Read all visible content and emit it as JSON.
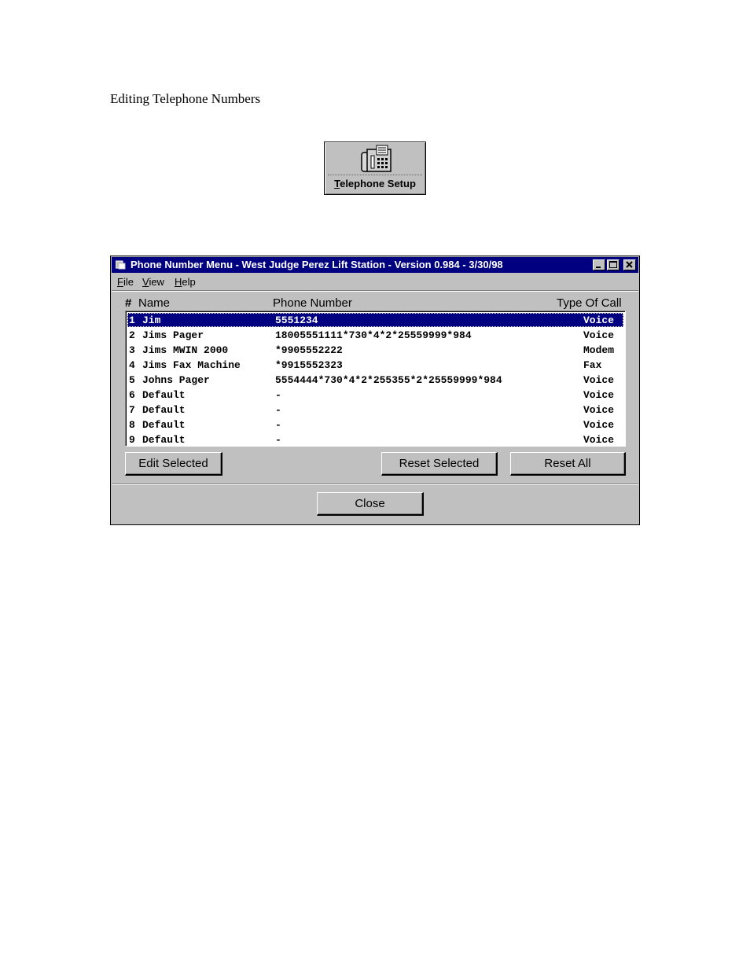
{
  "doc": {
    "heading": "Editing Telephone Numbers"
  },
  "telephone_button": {
    "label_first": "T",
    "label_rest": "elephone Setup",
    "icon": "telephone-fax-icon"
  },
  "window": {
    "title": "Phone Number Menu - West Judge Perez Lift Station - Version 0.984 - 3/30/98",
    "title_color": "#000080",
    "menu": [
      {
        "key": "F",
        "rest": "ile"
      },
      {
        "key": "V",
        "rest": "iew"
      },
      {
        "key": "H",
        "rest": "elp"
      }
    ],
    "columns": {
      "hash": "#",
      "name": "Name",
      "phone": "Phone Number",
      "type": "Type Of Call"
    },
    "rows": [
      {
        "num": "1",
        "name": "Jim",
        "phone": "5551234",
        "type": "Voice",
        "selected": true
      },
      {
        "num": "2",
        "name": "Jims Pager",
        "phone": "18005551111*730*4*2*25559999*984",
        "type": "Voice"
      },
      {
        "num": "3",
        "name": "Jims MWIN 2000",
        "phone": "*9905552222",
        "type": "Modem"
      },
      {
        "num": "4",
        "name": "Jims Fax Machine",
        "phone": "*9915552323",
        "type": "Fax"
      },
      {
        "num": "5",
        "name": "Johns Pager",
        "phone": "5554444*730*4*2*255355*2*25559999*984",
        "type": "Voice"
      },
      {
        "num": "6",
        "name": "Default",
        "phone": "-",
        "type": "Voice"
      },
      {
        "num": "7",
        "name": "Default",
        "phone": "-",
        "type": "Voice"
      },
      {
        "num": "8",
        "name": "Default",
        "phone": "-",
        "type": "Voice"
      },
      {
        "num": "9",
        "name": "Default",
        "phone": "-",
        "type": "Voice"
      }
    ],
    "buttons": {
      "edit": "Edit Selected",
      "reset_selected": "Reset Selected",
      "reset_all": "Reset All",
      "close": "Close"
    }
  }
}
